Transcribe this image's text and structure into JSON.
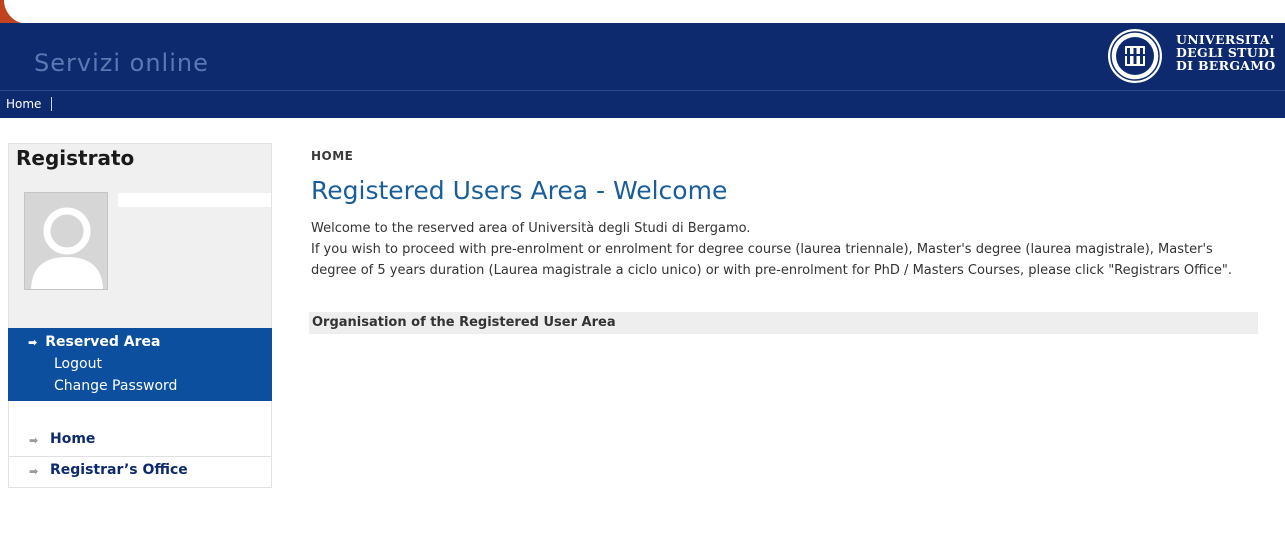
{
  "header": {
    "site_title": "Servizi online",
    "logo_lines": [
      "UNIVERSITA'",
      "DEGLI STUDI",
      "DI BERGAMO"
    ]
  },
  "topnav": {
    "home": "Home"
  },
  "sidebar": {
    "title": "Registrato",
    "reserved": {
      "heading": "Reserved Area",
      "links": [
        "Logout",
        "Change Password"
      ]
    },
    "nav": [
      {
        "label": "Home"
      },
      {
        "label": "Registrar’s Office"
      }
    ]
  },
  "main": {
    "breadcrumb": "HOME",
    "title": "Registered Users Area - Welcome",
    "intro_line1": "Welcome to the reserved area of Università degli Studi di Bergamo.",
    "intro_line2": "If you wish to proceed with pre-enrolment or enrolment for degree course (laurea triennale), Master's degree (laurea magistrale), Master's degree of 5 years duration (Laurea magistrale a ciclo unico) or with pre-enrolment for PhD / Masters Courses, please click \"Registrars Office\".",
    "section_title": "Organisation of the Registered User Area"
  },
  "colors": {
    "header_bg": "#0d2a6e",
    "reserved_bg": "#0b4f9e",
    "title_blue": "#1a5e99"
  }
}
